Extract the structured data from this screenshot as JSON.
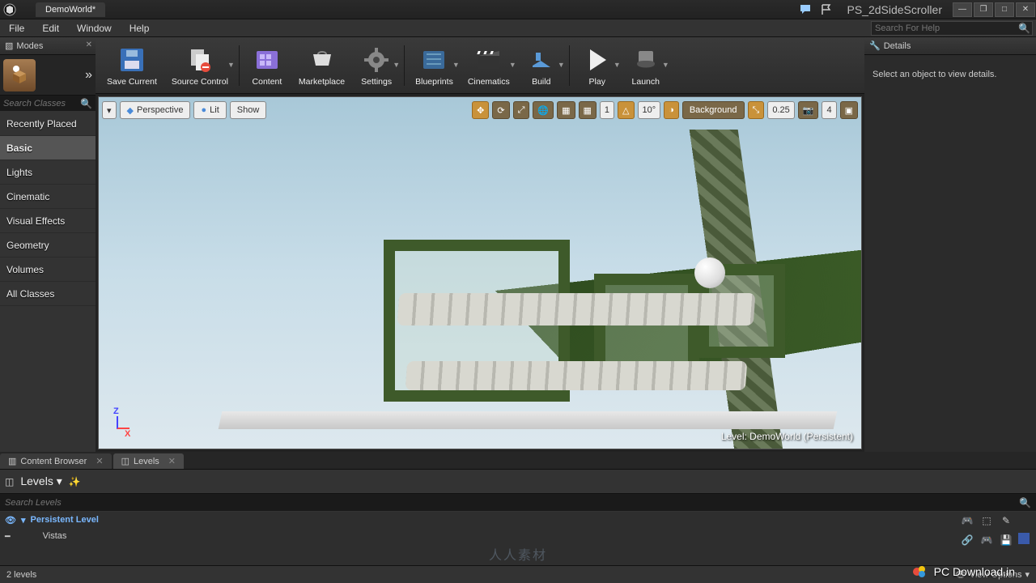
{
  "titlebar": {
    "tab": "DemoWorld*",
    "project": "PS_2dSideScroller"
  },
  "menu": {
    "items": [
      "File",
      "Edit",
      "Window",
      "Help"
    ],
    "search_placeholder": "Search For Help"
  },
  "modes": {
    "title": "Modes",
    "search_placeholder": "Search Classes",
    "categories": [
      "Recently Placed",
      "Basic",
      "Lights",
      "Cinematic",
      "Visual Effects",
      "Geometry",
      "Volumes",
      "All Classes"
    ],
    "active": "Basic"
  },
  "toolbar": {
    "save": "Save Current",
    "source_control": "Source Control",
    "content": "Content",
    "marketplace": "Marketplace",
    "settings": "Settings",
    "blueprints": "Blueprints",
    "cinematics": "Cinematics",
    "build": "Build",
    "play": "Play",
    "launch": "Launch"
  },
  "viewport": {
    "perspective": "Perspective",
    "lit": "Lit",
    "show": "Show",
    "snap_pos": "1",
    "snap_angle": "10°",
    "snap_scale": "0.25",
    "cam_speed": "4",
    "background": "Background",
    "level_label": "Level:  DemoWorld (Persistent)",
    "axis_z": "Z",
    "axis_x": "X"
  },
  "details": {
    "title": "Details",
    "empty": "Select an object to view details."
  },
  "bottom": {
    "tab_content_browser": "Content Browser",
    "tab_levels": "Levels",
    "levels_label": "Levels",
    "search_placeholder": "Search Levels",
    "persistent": "Persistent Level",
    "child": "Vistas",
    "count": "2 levels",
    "view_options": "View Options"
  },
  "watermark": {
    "text": "PC Download.in",
    "center": "人人素材"
  }
}
